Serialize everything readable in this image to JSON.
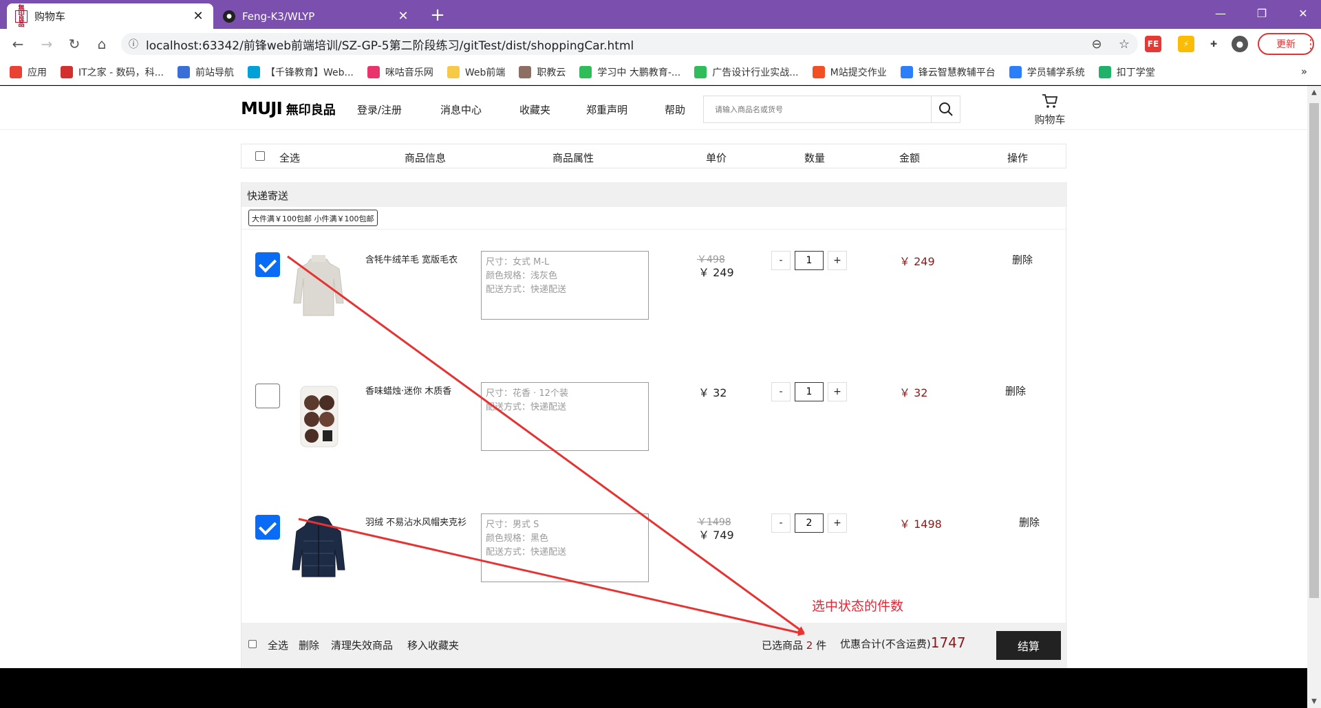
{
  "tabs": [
    {
      "title": "购物车",
      "favicon": "muji-favicon"
    },
    {
      "title": "Feng-K3/WLYP",
      "favicon": "github-icon"
    }
  ],
  "toolbar": {
    "url": "localhost:63342/前锋web前端培训/SZ-GP-5第二阶段练习/gitTest/dist/shoppingCar.html",
    "update_label": "更新"
  },
  "bookmarks": [
    {
      "label": "应用",
      "icon": "apps-grid-icon",
      "color": "#e94235"
    },
    {
      "label": "IT之家 - 数码，科...",
      "icon": "it-home-icon",
      "color": "#d32f2f"
    },
    {
      "label": "前站导航",
      "icon": "rocket-icon",
      "color": "#3b6fd8"
    },
    {
      "label": "【千锋教育】Web...",
      "icon": "bilibili-icon",
      "color": "#00a1d6"
    },
    {
      "label": "咪咕音乐网",
      "icon": "migu-icon",
      "color": "#e8336d"
    },
    {
      "label": "Web前端",
      "icon": "folder-icon",
      "color": "#f7c948"
    },
    {
      "label": "职教云",
      "icon": "zhijiaoyun-icon",
      "color": "#8d6e63"
    },
    {
      "label": "学习中 大鹏教育-...",
      "icon": "dp-icon",
      "color": "#2ebd59"
    },
    {
      "label": "广告设计行业实战...",
      "icon": "dp-icon",
      "color": "#2ebd59"
    },
    {
      "label": "M站提交作业",
      "icon": "windows-icon",
      "color": "#f25022"
    },
    {
      "label": "锋云智慧教辅平台",
      "icon": "fengyun-icon",
      "color": "#2d7ff9"
    },
    {
      "label": "学员辅学系统",
      "icon": "fengyun-icon",
      "color": "#2d7ff9"
    },
    {
      "label": "扣丁学堂",
      "icon": "koding-icon",
      "color": "#20b26b"
    }
  ],
  "header": {
    "logo_en": "MUJI",
    "logo_cn": "無印良品",
    "nav": [
      "登录/注册",
      "消息中心",
      "收藏夹",
      "郑重声明",
      "帮助"
    ],
    "search_placeholder": "请输入商品名或货号",
    "cart_label": "购物车"
  },
  "table_header": {
    "select_all": "全选",
    "columns": [
      "商品信息",
      "商品属性",
      "单价",
      "数量",
      "金额",
      "操作"
    ]
  },
  "section": {
    "title": "快递寄送",
    "promo": "大件满￥100包邮 小件满￥100包邮"
  },
  "items": [
    {
      "checked": true,
      "name": "含牦牛绒羊毛 宽版毛衣",
      "image": "sweater",
      "attrs": [
        "尺寸：女式 M-L",
        "颜色规格：浅灰色",
        "配送方式：快递配送"
      ],
      "old_price": "￥498",
      "price": "￥ 249",
      "qty": "1",
      "subtotal": "￥ 249",
      "delete": "删除"
    },
    {
      "checked": false,
      "name": "香味蜡烛·迷你 木质香",
      "image": "candles",
      "attrs": [
        "尺寸：花香 · 12个装",
        "配送方式：快递配送"
      ],
      "old_price": "",
      "price": "￥ 32",
      "qty": "1",
      "subtotal": "￥ 32",
      "delete": "删除"
    },
    {
      "checked": true,
      "name": "羽绒 不易沾水风帽夹克衫",
      "image": "down-jacket",
      "attrs": [
        "尺寸：男式 S",
        "颜色规格：黑色",
        "配送方式：快递配送"
      ],
      "old_price": "￥1498",
      "price": "￥ 749",
      "qty": "2",
      "subtotal": "￥ 1498",
      "delete": "删除"
    }
  ],
  "footer": {
    "select_all": "全选",
    "delete": "删除",
    "clear_invalid": "清理失效商品",
    "move_to_fav": "移入收藏夹",
    "selected_prefix": "已选商品",
    "selected_count": "2",
    "selected_unit": "件",
    "total_label": "优惠合计(不含运费)",
    "total_value": "1747",
    "checkout": "结算"
  },
  "annotation": {
    "text": "选中状态的件数",
    "color": "#e23232"
  },
  "colors": {
    "tabbar": "#7a4fae",
    "accent_checkbox": "#0a6cf5",
    "price_red": "#8b1a1a"
  }
}
